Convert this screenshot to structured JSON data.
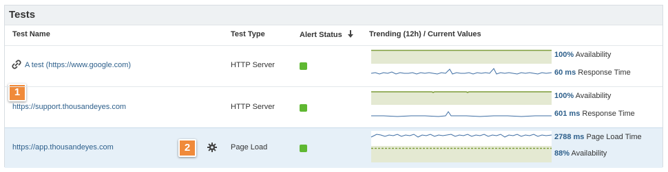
{
  "panel": {
    "title": "Tests"
  },
  "columns": {
    "test_name": "Test Name",
    "test_type": "Test Type",
    "alert_status": "Alert Status",
    "trending": "Trending (12h) / Current Values"
  },
  "sort_icon": "arrow-down-icon",
  "rows": [
    {
      "name": "A test (https://www.google.com)",
      "type": "HTTP Server",
      "status_color": "#5fb832",
      "icon": "link-icon",
      "badge": "1",
      "metric1": {
        "value": "100%",
        "label": "Availability"
      },
      "metric2": {
        "value": "60 ms",
        "label": "Response Time"
      }
    },
    {
      "name": "https://support.thousandeyes.com",
      "type": "HTTP Server",
      "status_color": "#5fb832",
      "metric1": {
        "value": "100%",
        "label": "Availability"
      },
      "metric2": {
        "value": "601 ms",
        "label": "Response Time"
      }
    },
    {
      "name": "https://app.thousandeyes.com",
      "type": "Page Load",
      "status_color": "#5fb832",
      "icon": "gear-icon",
      "badge": "2",
      "metric1": {
        "value": "2788 ms",
        "label": "Page Load Time"
      },
      "metric2": {
        "value": "88%",
        "label": "Availability"
      }
    }
  ],
  "colors": {
    "link": "#2d5f8b",
    "availability_fill": "#e4e9d2",
    "availability_line": "#7f9e3d",
    "response_line": "#3d6da3",
    "badge": "#f08a3a"
  }
}
